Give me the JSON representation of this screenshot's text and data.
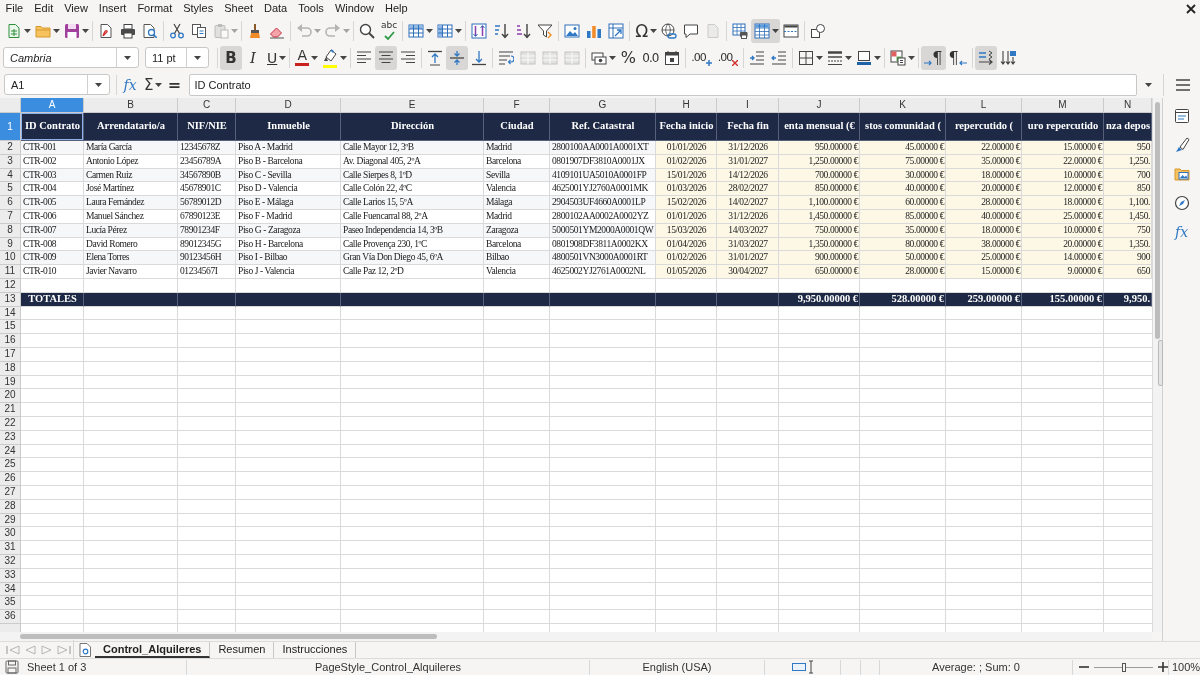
{
  "menu_bar": {
    "items": [
      "File",
      "Edit",
      "View",
      "Insert",
      "Format",
      "Styles",
      "Sheet",
      "Data",
      "Tools",
      "Window",
      "Help"
    ]
  },
  "standard_toolbar": {
    "buttons": [
      {
        "pressed": false,
        "disabled": false
      },
      {
        "pressed": false,
        "disabled": false
      },
      {
        "pressed": false,
        "disabled": false
      },
      {
        "pressed": false,
        "disabled": false
      },
      {
        "pressed": false,
        "disabled": false
      },
      {
        "pressed": false,
        "disabled": false
      },
      {
        "pressed": false,
        "disabled": false
      },
      {
        "pressed": false,
        "disabled": false
      },
      {
        "pressed": false,
        "disabled": true
      },
      {
        "pressed": false,
        "disabled": false
      },
      {
        "pressed": false,
        "disabled": false
      },
      {
        "pressed": false,
        "disabled": true
      },
      {
        "pressed": false,
        "disabled": true
      },
      {
        "pressed": false,
        "disabled": false
      },
      {
        "glyph": "abc",
        "pressed": false,
        "disabled": false
      },
      {
        "pressed": false,
        "disabled": false
      },
      {
        "pressed": false,
        "disabled": false
      },
      {
        "pressed": false,
        "disabled": false
      },
      {
        "pressed": false,
        "disabled": false
      },
      {
        "pressed": false,
        "disabled": false
      },
      {
        "pressed": false,
        "disabled": false
      },
      {
        "pressed": false,
        "disabled": false
      },
      {
        "pressed": false,
        "disabled": false
      },
      {
        "pressed": false,
        "disabled": false
      },
      {
        "glyph": "Ω",
        "pressed": false,
        "disabled": false
      },
      {
        "pressed": false,
        "disabled": false
      },
      {
        "pressed": false,
        "disabled": false
      },
      {
        "pressed": false,
        "disabled": true
      },
      {
        "pressed": false,
        "disabled": false
      },
      {
        "pressed": true,
        "disabled": false
      },
      {
        "pressed": false,
        "disabled": false
      },
      {
        "pressed": false,
        "disabled": false
      }
    ]
  },
  "formatting_toolbar": {
    "font_name": "Cambria",
    "font_size": "11 pt",
    "buttons": [
      {
        "glyph": "B",
        "pressed": true,
        "disabled": false
      },
      {
        "glyph": "I",
        "pressed": false,
        "disabled": false
      },
      {
        "glyph": "U",
        "pressed": false,
        "disabled": false
      },
      {
        "glyph": "A",
        "color": "#c9211e",
        "pressed": false,
        "disabled": false
      },
      {
        "color": "#ffff00",
        "pressed": false,
        "disabled": false
      },
      {
        "pressed": false,
        "disabled": false
      },
      {
        "pressed": true,
        "disabled": false
      },
      {
        "pressed": false,
        "disabled": false
      },
      {
        "pressed": false,
        "disabled": false
      },
      {
        "pressed": true,
        "disabled": false
      },
      {
        "pressed": false,
        "disabled": false
      },
      {
        "pressed": false,
        "disabled": false
      },
      {
        "pressed": false,
        "disabled": true
      },
      {
        "pressed": false,
        "disabled": true
      },
      {
        "pressed": false,
        "disabled": true
      },
      {
        "pressed": false,
        "disabled": false
      },
      {
        "glyph": "%",
        "pressed": false,
        "disabled": false
      },
      {
        "glyph": "0.0",
        "pressed": false,
        "disabled": false
      },
      {
        "pressed": false,
        "disabled": false
      },
      {
        "glyph": ".00",
        "pressed": false,
        "disabled": false
      },
      {
        "glyph": ".00",
        "pressed": false,
        "disabled": false
      },
      {
        "pressed": false,
        "disabled": false
      },
      {
        "pressed": false,
        "disabled": false
      },
      {
        "pressed": false,
        "disabled": false
      },
      {
        "pressed": false,
        "disabled": false
      },
      {
        "pressed": false,
        "disabled": false
      },
      {
        "pressed": false,
        "disabled": false
      },
      {
        "glyph": "¶",
        "pressed": true,
        "disabled": false
      },
      {
        "glyph": "¶",
        "pressed": false,
        "disabled": false
      },
      {
        "pressed": true,
        "disabled": false
      },
      {
        "pressed": false,
        "disabled": false
      }
    ]
  },
  "formula_bar": {
    "name_box": "A1",
    "buttons": [
      {
        "glyph": "fx"
      },
      {
        "glyph": "Σ"
      },
      {
        "glyph": "="
      }
    ],
    "formula": "ID Contrato"
  },
  "sidebar": {
    "buttons": [
      {
        "selected": false
      },
      {
        "selected": false
      },
      {
        "selected": false
      },
      {
        "selected": false
      },
      {
        "glyph": "fx",
        "selected": false
      }
    ]
  },
  "sheet": {
    "columns": [
      {
        "label": "A",
        "kind": "text",
        "selected": true
      },
      {
        "label": "B",
        "kind": "text",
        "selected": false
      },
      {
        "label": "C",
        "kind": "text",
        "selected": false
      },
      {
        "label": "D",
        "kind": "text",
        "selected": false
      },
      {
        "label": "E",
        "kind": "text",
        "selected": false
      },
      {
        "label": "F",
        "kind": "text",
        "selected": false
      },
      {
        "label": "G",
        "kind": "text",
        "selected": false
      },
      {
        "label": "H",
        "kind": "date",
        "selected": false
      },
      {
        "label": "I",
        "kind": "date",
        "selected": false
      },
      {
        "label": "J",
        "kind": "money",
        "selected": false
      },
      {
        "label": "K",
        "kind": "money",
        "selected": false
      },
      {
        "label": "L",
        "kind": "money",
        "selected": false
      },
      {
        "label": "M",
        "kind": "money",
        "selected": false
      },
      {
        "label": "N",
        "kind": "money",
        "selected": false
      }
    ],
    "rows": [
      {
        "kind": "header",
        "number": "1",
        "selected": true,
        "cells": [
          "ID Contrato",
          "Arrendatario/a",
          "NIF/NIE",
          "Inmueble",
          "Dirección",
          "Ciudad",
          "Ref. Catastral",
          "Fecha inicio",
          "Fecha fin",
          "enta mensual (€",
          "stos comunidad (",
          "repercutido (",
          "uro repercutido",
          "nza depos"
        ]
      },
      {
        "kind": "data",
        "number": "2",
        "selected": false,
        "cells": [
          "CTR-001",
          "María García",
          "12345678Z",
          "Piso A - Madrid",
          "Calle Mayor 12, 3ºB",
          "Madrid",
          "2800100AA0001A0001XT",
          "01/01/2026",
          "31/12/2026",
          "950.00000 €",
          "45.00000 €",
          "22.00000 €",
          "15.00000 €",
          "950"
        ]
      },
      {
        "kind": "data",
        "number": "3",
        "selected": false,
        "cells": [
          "CTR-002",
          "Antonio López",
          "23456789A",
          "Piso B - Barcelona",
          "Av. Diagonal 405, 2ºA",
          "Barcelona",
          "0801907DF3810A0001JX",
          "01/02/2026",
          "31/01/2027",
          "1,250.00000 €",
          "75.00000 €",
          "35.00000 €",
          "22.00000 €",
          "1,250."
        ]
      },
      {
        "kind": "data",
        "number": "4",
        "selected": false,
        "cells": [
          "CTR-003",
          "Carmen Ruiz",
          "34567890B",
          "Piso C - Sevilla",
          "Calle Sierpes 8, 1ºD",
          "Sevilla",
          "4109101UA5010A0001FP",
          "15/01/2026",
          "14/12/2026",
          "700.00000 €",
          "30.00000 €",
          "18.00000 €",
          "10.00000 €",
          "700"
        ]
      },
      {
        "kind": "data",
        "number": "5",
        "selected": false,
        "cells": [
          "CTR-004",
          "José Martínez",
          "45678901C",
          "Piso D - Valencia",
          "Calle Colón 22, 4ºC",
          "Valencia",
          "4625001YJ2760A0001MK",
          "01/03/2026",
          "28/02/2027",
          "850.00000 €",
          "40.00000 €",
          "20.00000 €",
          "12.00000 €",
          "850"
        ]
      },
      {
        "kind": "data",
        "number": "6",
        "selected": false,
        "cells": [
          "CTR-005",
          "Laura Fernández",
          "56789012D",
          "Piso E - Málaga",
          "Calle Larios 15, 5ºA",
          "Málaga",
          "2904503UF4660A0001LP",
          "15/02/2026",
          "14/02/2027",
          "1,100.00000 €",
          "60.00000 €",
          "28.00000 €",
          "18.00000 €",
          "1,100."
        ]
      },
      {
        "kind": "data",
        "number": "7",
        "selected": false,
        "cells": [
          "CTR-006",
          "Manuel Sánchez",
          "67890123E",
          "Piso F - Madrid",
          "Calle Fuencarral 88, 2ºA",
          "Madrid",
          "2800102AA0002A0002YZ",
          "01/01/2026",
          "31/12/2026",
          "1,450.00000 €",
          "85.00000 €",
          "40.00000 €",
          "25.00000 €",
          "1,450."
        ]
      },
      {
        "kind": "data",
        "number": "8",
        "selected": false,
        "cells": [
          "CTR-007",
          "Lucía Pérez",
          "78901234F",
          "Piso G - Zaragoza",
          "Paseo Independencia 14, 3ºB",
          "Zaragoza",
          "5000501YM2000A0001QW",
          "15/03/2026",
          "14/03/2027",
          "750.00000 €",
          "35.00000 €",
          "18.00000 €",
          "10.00000 €",
          "750"
        ]
      },
      {
        "kind": "data",
        "number": "9",
        "selected": false,
        "cells": [
          "CTR-008",
          "David Romero",
          "89012345G",
          "Piso H - Barcelona",
          "Calle Provença 230, 1ºC",
          "Barcelona",
          "0801908DF3811A0002KX",
          "01/04/2026",
          "31/03/2027",
          "1,350.00000 €",
          "80.00000 €",
          "38.00000 €",
          "20.00000 €",
          "1,350."
        ]
      },
      {
        "kind": "data",
        "number": "10",
        "selected": false,
        "cells": [
          "CTR-009",
          "Elena Torres",
          "90123456H",
          "Piso I - Bilbao",
          "Gran Vía Don Diego 45, 6ºA",
          "Bilbao",
          "4800501VN3000A0001RT",
          "01/02/2026",
          "31/01/2027",
          "900.00000 €",
          "50.00000 €",
          "25.00000 €",
          "14.00000 €",
          "900"
        ]
      },
      {
        "kind": "data",
        "number": "11",
        "selected": false,
        "cells": [
          "CTR-010",
          "Javier Navarro",
          "01234567I",
          "Piso J - Valencia",
          "Calle Paz 12, 2ºD",
          "Valencia",
          "4625002YJ2761A0002NL",
          "01/05/2026",
          "30/04/2027",
          "650.00000 €",
          "28.00000 €",
          "15.00000 €",
          "9.00000 €",
          "650"
        ]
      },
      {
        "kind": "blank",
        "number": "12",
        "selected": false
      },
      {
        "kind": "total",
        "number": "13",
        "selected": false,
        "label": "TOTALES",
        "amounts": [
          "9,950.00000 €",
          "528.00000 €",
          "259.00000 €",
          "155.00000 €",
          "9,950."
        ]
      },
      {
        "kind": "blank",
        "number": "14",
        "selected": false
      },
      {
        "kind": "blank",
        "number": "15",
        "selected": false
      },
      {
        "kind": "blank",
        "number": "16",
        "selected": false
      },
      {
        "kind": "blank",
        "number": "17",
        "selected": false
      },
      {
        "kind": "blank",
        "number": "18",
        "selected": false
      },
      {
        "kind": "blank",
        "number": "19",
        "selected": false
      },
      {
        "kind": "blank",
        "number": "20",
        "selected": false
      },
      {
        "kind": "blank",
        "number": "21",
        "selected": false
      },
      {
        "kind": "blank",
        "number": "22",
        "selected": false
      },
      {
        "kind": "blank",
        "number": "23",
        "selected": false
      },
      {
        "kind": "blank",
        "number": "24",
        "selected": false
      },
      {
        "kind": "blank",
        "number": "25",
        "selected": false
      },
      {
        "kind": "blank",
        "number": "26",
        "selected": false
      },
      {
        "kind": "blank",
        "number": "27",
        "selected": false
      },
      {
        "kind": "blank",
        "number": "28",
        "selected": false
      },
      {
        "kind": "blank",
        "number": "29",
        "selected": false
      },
      {
        "kind": "blank",
        "number": "30",
        "selected": false
      },
      {
        "kind": "blank",
        "number": "31",
        "selected": false
      },
      {
        "kind": "blank",
        "number": "32",
        "selected": false
      },
      {
        "kind": "blank",
        "number": "33",
        "selected": false
      },
      {
        "kind": "blank",
        "number": "34",
        "selected": false
      },
      {
        "kind": "blank",
        "number": "35",
        "selected": false
      },
      {
        "kind": "blank",
        "number": "36",
        "selected": false
      }
    ]
  },
  "sheet_tabs": {
    "navigation": [
      {
        "disabled": true
      },
      {
        "disabled": true
      },
      {
        "disabled": true
      },
      {
        "disabled": true
      }
    ],
    "tabs": [
      {
        "label": "Control_Alquileres",
        "selected": true
      },
      {
        "label": "Resumen",
        "selected": false
      },
      {
        "label": "Instrucciones",
        "selected": false
      }
    ]
  },
  "status_bar": {
    "sheet_position": "Sheet 1 of 3",
    "page_style": "PageStyle_Control_Alquileres",
    "language": "English (USA)",
    "selection_summary": "Average: ; Sum: 0",
    "zoom": {
      "level": 0.5,
      "reading": "100%"
    }
  }
}
